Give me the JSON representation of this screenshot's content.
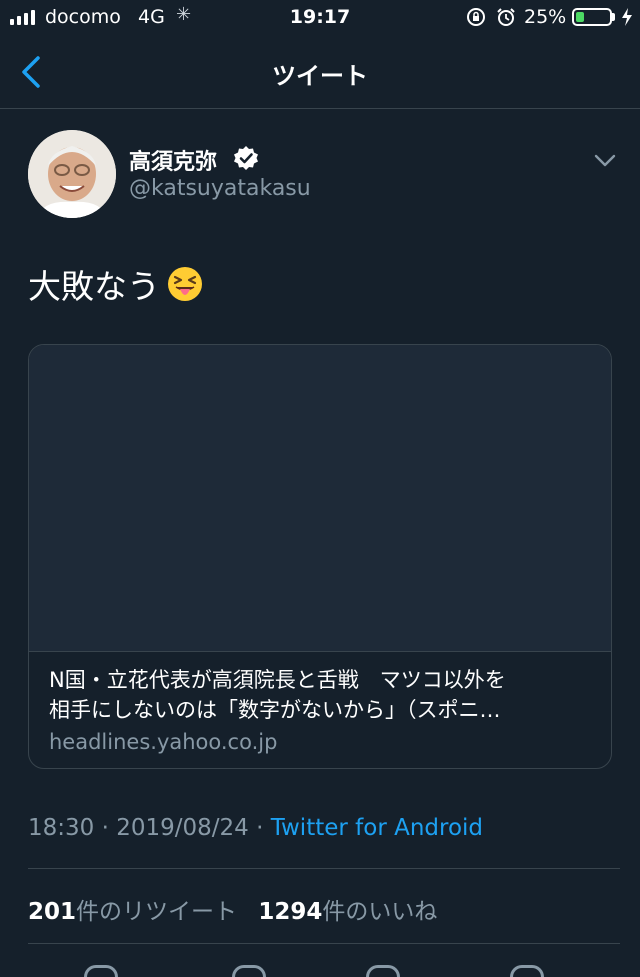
{
  "status_bar": {
    "carrier": "docomo",
    "network": "4G",
    "time": "19:17",
    "battery_percent": "25%",
    "battery_level": 0.25,
    "icons": [
      "signal-icon",
      "activity-spinner-icon",
      "rotation-lock-icon",
      "alarm-icon",
      "battery-icon",
      "charging-bolt-icon"
    ]
  },
  "nav": {
    "title": "ツイート",
    "back_icon": "chevron-left-icon"
  },
  "tweet": {
    "display_name": "高須克弥",
    "handle": "@katsuyatakasu",
    "verified": true,
    "text": "大敗なう",
    "emoji": "squinting-face-with-tongue",
    "card": {
      "title_line1": "N国・立花代表が高須院長と舌戦　マツコ以外を",
      "title_line2": "相手にしないのは「数字がないから」（スポニ…",
      "domain": "headlines.yahoo.co.jp"
    },
    "time": "18:30",
    "date": "2019/08/24",
    "separator": " · ",
    "client": "Twitter for Android",
    "retweets_count": "201",
    "retweets_label": "件のリツイート",
    "likes_count": "1294",
    "likes_label": "件のいいね"
  },
  "colors": {
    "background": "#15202b",
    "accent": "#1da1f2",
    "secondary_text": "#8899a6",
    "divider": "#38444d"
  }
}
